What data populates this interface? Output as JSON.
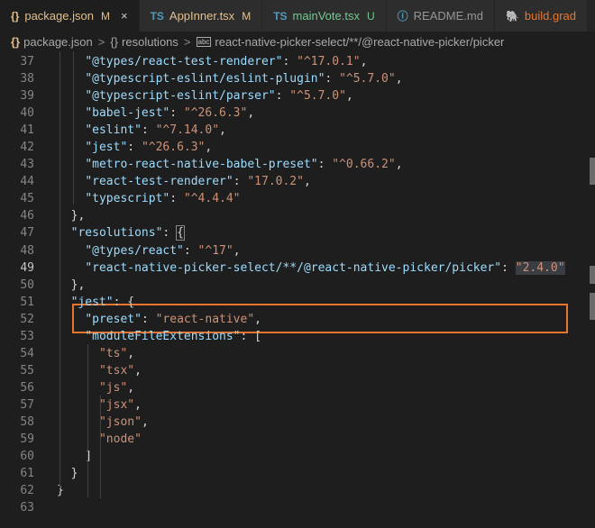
{
  "tabs": [
    {
      "icon": "{}",
      "label": "package.json",
      "status": "M",
      "active": true,
      "close": "×"
    },
    {
      "icon": "TS",
      "label": "AppInner.tsx",
      "status": "M",
      "active": false
    },
    {
      "icon": "TS",
      "label": "mainVote.tsx",
      "status": "U",
      "active": false
    },
    {
      "icon": "ⓘ",
      "label": "README.md",
      "status": "",
      "active": false
    },
    {
      "icon": "🐘",
      "label": "build.grad",
      "status": "",
      "active": false
    }
  ],
  "breadcrumb": {
    "file_icon": "{}",
    "file": "package.json",
    "obj_icon": "{}",
    "obj": "resolutions",
    "key_icon": "abc",
    "key": "react-native-picker-select/**/@react-native-picker/picker",
    "separator": ">"
  },
  "lines": [
    {
      "n": "37",
      "parts": [
        [
          "p",
          "    "
        ],
        [
          "k",
          "\"@types/react-test-renderer\""
        ],
        [
          "p",
          ": "
        ],
        [
          "s",
          "\"^17.0.1\""
        ],
        [
          "p",
          ","
        ]
      ]
    },
    {
      "n": "38",
      "parts": [
        [
          "p",
          "    "
        ],
        [
          "k",
          "\"@typescript-eslint/eslint-plugin\""
        ],
        [
          "p",
          ": "
        ],
        [
          "s",
          "\"^5.7.0\""
        ],
        [
          "p",
          ","
        ]
      ]
    },
    {
      "n": "39",
      "parts": [
        [
          "p",
          "    "
        ],
        [
          "k",
          "\"@typescript-eslint/parser\""
        ],
        [
          "p",
          ": "
        ],
        [
          "s",
          "\"^5.7.0\""
        ],
        [
          "p",
          ","
        ]
      ]
    },
    {
      "n": "40",
      "parts": [
        [
          "p",
          "    "
        ],
        [
          "k",
          "\"babel-jest\""
        ],
        [
          "p",
          ": "
        ],
        [
          "s",
          "\"^26.6.3\""
        ],
        [
          "p",
          ","
        ]
      ]
    },
    {
      "n": "41",
      "parts": [
        [
          "p",
          "    "
        ],
        [
          "k",
          "\"eslint\""
        ],
        [
          "p",
          ": "
        ],
        [
          "s",
          "\"^7.14.0\""
        ],
        [
          "p",
          ","
        ]
      ]
    },
    {
      "n": "42",
      "parts": [
        [
          "p",
          "    "
        ],
        [
          "k",
          "\"jest\""
        ],
        [
          "p",
          ": "
        ],
        [
          "s",
          "\"^26.6.3\""
        ],
        [
          "p",
          ","
        ]
      ]
    },
    {
      "n": "43",
      "parts": [
        [
          "p",
          "    "
        ],
        [
          "k",
          "\"metro-react-native-babel-preset\""
        ],
        [
          "p",
          ": "
        ],
        [
          "s",
          "\"^0.66.2\""
        ],
        [
          "p",
          ","
        ]
      ]
    },
    {
      "n": "44",
      "parts": [
        [
          "p",
          "    "
        ],
        [
          "k",
          "\"react-test-renderer\""
        ],
        [
          "p",
          ": "
        ],
        [
          "s",
          "\"17.0.2\""
        ],
        [
          "p",
          ","
        ]
      ]
    },
    {
      "n": "45",
      "parts": [
        [
          "p",
          "    "
        ],
        [
          "k",
          "\"typescript\""
        ],
        [
          "p",
          ": "
        ],
        [
          "s",
          "\"^4.4.4\""
        ]
      ]
    },
    {
      "n": "46",
      "parts": [
        [
          "p",
          "  },"
        ]
      ]
    },
    {
      "n": "47",
      "parts": [
        [
          "p",
          "  "
        ],
        [
          "k",
          "\"resolutions\""
        ],
        [
          "p",
          ": "
        ],
        [
          "p",
          "{"
        ]
      ]
    },
    {
      "n": "48",
      "parts": [
        [
          "p",
          "    "
        ],
        [
          "k",
          "\"@types/react\""
        ],
        [
          "p",
          ": "
        ],
        [
          "s",
          "\"^17\""
        ],
        [
          "p",
          ","
        ]
      ]
    },
    {
      "n": "49",
      "parts": [
        [
          "p",
          "    "
        ],
        [
          "k",
          "\"react-native-picker-select/**/@react-native-picker/picker\""
        ],
        [
          "p",
          ": "
        ],
        [
          "s",
          "\"2.4.0\""
        ]
      ]
    },
    {
      "n": "50",
      "parts": [
        [
          "p",
          "  },"
        ]
      ]
    },
    {
      "n": "51",
      "parts": [
        [
          "p",
          "  "
        ],
        [
          "k",
          "\"jest\""
        ],
        [
          "p",
          ": {"
        ]
      ]
    },
    {
      "n": "52",
      "parts": [
        [
          "p",
          "    "
        ],
        [
          "k",
          "\"preset\""
        ],
        [
          "p",
          ": "
        ],
        [
          "s",
          "\"react-native\""
        ],
        [
          "p",
          ","
        ]
      ]
    },
    {
      "n": "53",
      "parts": [
        [
          "p",
          "    "
        ],
        [
          "k",
          "\"moduleFileExtensions\""
        ],
        [
          "p",
          ": ["
        ]
      ]
    },
    {
      "n": "54",
      "parts": [
        [
          "p",
          "      "
        ],
        [
          "s",
          "\"ts\""
        ],
        [
          "p",
          ","
        ]
      ]
    },
    {
      "n": "55",
      "parts": [
        [
          "p",
          "      "
        ],
        [
          "s",
          "\"tsx\""
        ],
        [
          "p",
          ","
        ]
      ]
    },
    {
      "n": "56",
      "parts": [
        [
          "p",
          "      "
        ],
        [
          "s",
          "\"js\""
        ],
        [
          "p",
          ","
        ]
      ]
    },
    {
      "n": "57",
      "parts": [
        [
          "p",
          "      "
        ],
        [
          "s",
          "\"jsx\""
        ],
        [
          "p",
          ","
        ]
      ]
    },
    {
      "n": "58",
      "parts": [
        [
          "p",
          "      "
        ],
        [
          "s",
          "\"json\""
        ],
        [
          "p",
          ","
        ]
      ]
    },
    {
      "n": "59",
      "parts": [
        [
          "p",
          "      "
        ],
        [
          "s",
          "\"node\""
        ]
      ]
    },
    {
      "n": "60",
      "parts": [
        [
          "p",
          "    ]"
        ]
      ]
    },
    {
      "n": "61",
      "parts": [
        [
          "p",
          "  }"
        ]
      ]
    },
    {
      "n": "62",
      "parts": [
        [
          "p",
          "}"
        ]
      ]
    },
    {
      "n": "63",
      "parts": [
        [
          "p",
          ""
        ]
      ]
    }
  ],
  "current_line": "49",
  "colors": {
    "key": "#9cdcfe",
    "string": "#ce9178",
    "highlight_box": "#e8752f",
    "modified": "#e2c08d",
    "untracked": "#73c991"
  }
}
